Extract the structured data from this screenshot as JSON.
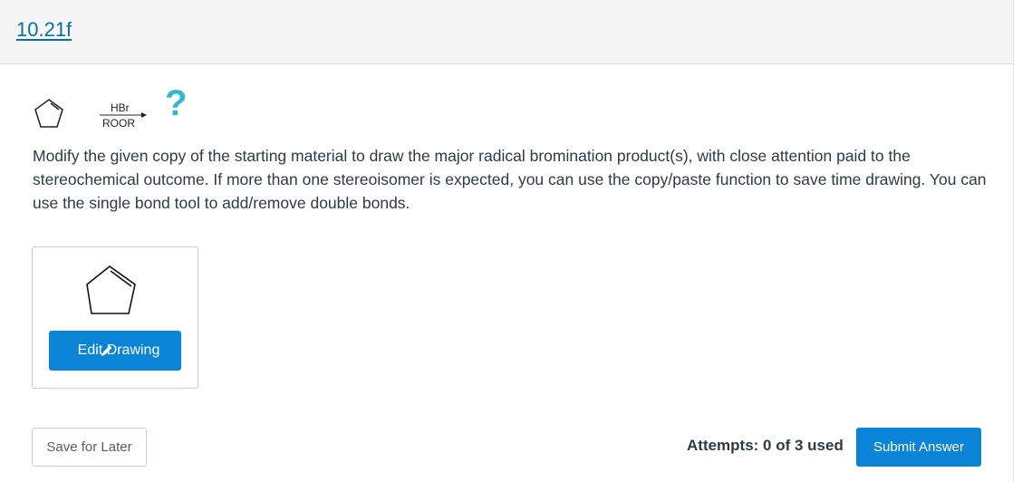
{
  "header": {
    "title": "10.21f"
  },
  "reaction": {
    "reagent_top": "HBr",
    "reagent_bottom": "ROOR",
    "unknown_product": "?",
    "starting_material_icon": "cyclopentene-structure-icon"
  },
  "question": {
    "instructions": "Modify the given copy of the starting material to draw the major radical bromination product(s), with close attention paid to the stereochemical outcome. If more than one stereoisomer is expected, you can use the copy/paste function to save time drawing. You can use the single bond tool to add/remove double bonds."
  },
  "drawing": {
    "structure_icon": "cyclopentene-structure-icon",
    "edit_label": "Edit Drawing",
    "edit_icon": "pencil-icon"
  },
  "footer": {
    "save_label": "Save for Later",
    "attempts_text": "Attempts: 0 of 3 used",
    "submit_label": "Submit Answer"
  },
  "colors": {
    "link": "#0770a3",
    "primary_button": "#0a84d6",
    "question_mark": "#2fb9cf",
    "header_bg": "#f5f5f5"
  }
}
